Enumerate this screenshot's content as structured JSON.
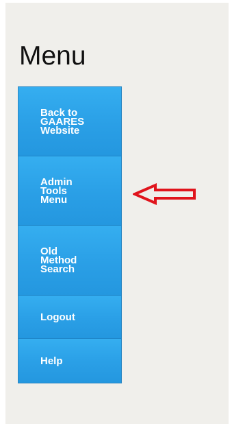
{
  "page": {
    "title": "Menu"
  },
  "menu": {
    "items": [
      {
        "label": "Back to\nGAARES\nWebsite"
      },
      {
        "label": "Admin\nTools\nMenu"
      },
      {
        "label": "Old\nMethod\nSearch"
      },
      {
        "label": "Logout"
      },
      {
        "label": "Help"
      }
    ]
  },
  "annotation": {
    "arrow_icon": "left-arrow-outline-icon",
    "arrow_color": "#e0141c"
  },
  "colors": {
    "page_background": "#f0efeb",
    "menu_item_background": "#2ea3ea",
    "menu_item_text": "#ffffff"
  }
}
